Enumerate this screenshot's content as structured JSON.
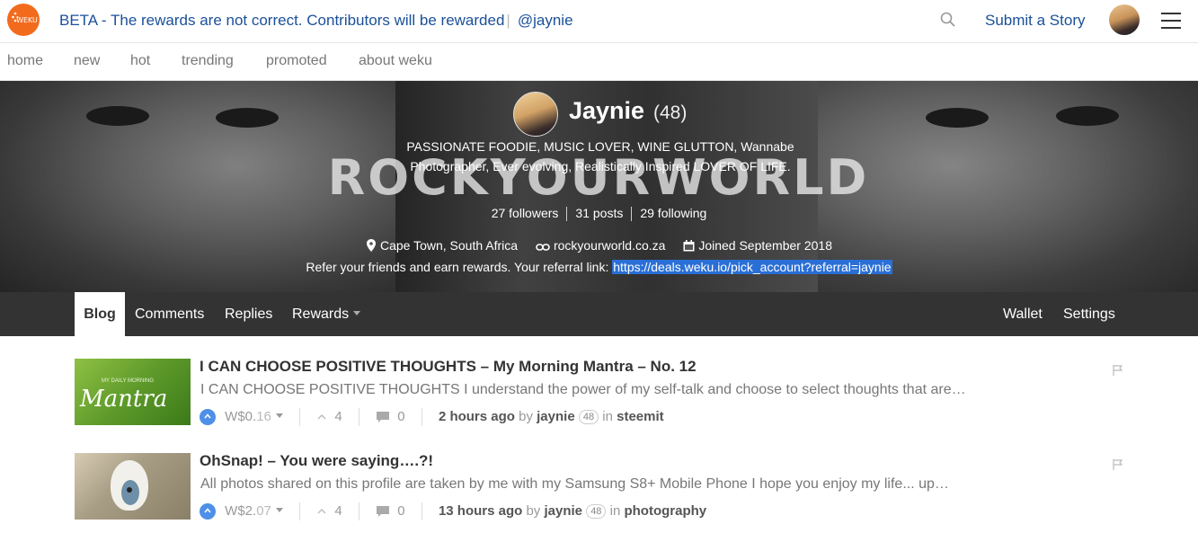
{
  "topbar": {
    "logo_text": "WEKU",
    "beta_notice": "BETA - The rewards are not correct. Contributors will be rewarded",
    "handle": "@jaynie",
    "submit_label": "Submit a Story"
  },
  "nav": {
    "items": [
      "home",
      "new",
      "hot",
      "trending",
      "promoted",
      "about weku"
    ]
  },
  "profile": {
    "name": "Jaynie",
    "reputation": "(48)",
    "about": "PASSIONATE FOODIE, MUSIC LOVER, WINE GLUTTON, Wannabe Photographer, Ever evolving, Realistically Inspired LOVER OF LIFE.",
    "cover_text": "ROCKYOURWORLD",
    "followers": "27 followers",
    "posts": "31 posts",
    "following": "29 following",
    "location": "Cape Town, South Africa",
    "website": "rockyourworld.co.za",
    "joined": "Joined September 2018",
    "referral_text": "Refer your friends and earn rewards. Your referral link:",
    "referral_link": "https://deals.weku.io/pick_account?referral=jaynie"
  },
  "tabs": {
    "blog": "Blog",
    "comments": "Comments",
    "replies": "Replies",
    "rewards": "Rewards",
    "wallet": "Wallet",
    "settings": "Settings"
  },
  "posts": [
    {
      "title": "I CAN CHOOSE POSITIVE THOUGHTS – My Morning Mantra – No. 12",
      "excerpt": "I CAN CHOOSE POSITIVE THOUGHTS I understand the power of my self-talk and choose to select thoughts that are…",
      "payout_main": "W$0.",
      "payout_cents": "16",
      "votes": "4",
      "comments": "0",
      "time": "2 hours ago",
      "by": "by",
      "author": "jaynie",
      "author_rep": "48",
      "in": "in",
      "category": "steemit",
      "thumb_text": "Mantra",
      "thumb_small": "MY DAILY MORNING"
    },
    {
      "title": "OhSnap! – You were saying….?!",
      "excerpt": "All photos shared on this profile are taken by me with my Samsung S8+ Mobile Phone I hope you enjoy my life... up…",
      "payout_main": "W$2.",
      "payout_cents": "07",
      "votes": "4",
      "comments": "0",
      "time": "13 hours ago",
      "by": "by",
      "author": "jaynie",
      "author_rep": "48",
      "in": "in",
      "category": "photography"
    }
  ],
  "colors": {
    "brand_orange": "#f26b1d",
    "link_blue": "#1a5099",
    "upvote_blue": "#4e8fe8",
    "tabbar_bg": "#333333",
    "referral_highlight": "#2a6fd6"
  }
}
